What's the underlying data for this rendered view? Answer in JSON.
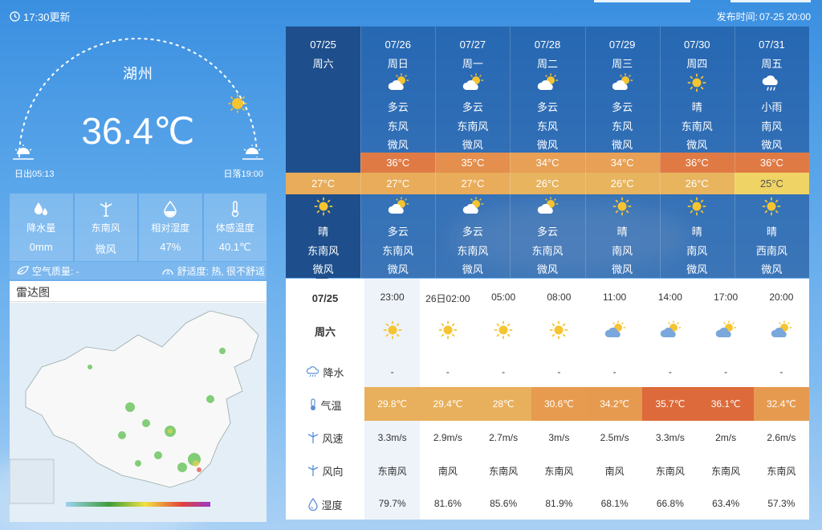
{
  "top": {
    "update_time": "17:30更新",
    "publish_label": "发布时间:",
    "publish_time": "07-25 20:00"
  },
  "current": {
    "city": "湖州",
    "temperature": "36.4℃",
    "sunrise": "日出05:13",
    "sunset": "日落19:00",
    "stats": [
      {
        "label": "降水量",
        "value": "0mm",
        "icon": "raindrops-icon"
      },
      {
        "label": "东南风",
        "value": "微风",
        "icon": "wind-turbine-icon"
      },
      {
        "label": "相对湿度",
        "value": "47%",
        "icon": "humidity-drop-icon"
      },
      {
        "label": "体感温度",
        "value": "40.1℃",
        "icon": "thermometer-icon"
      }
    ],
    "air_quality": "空气质量: -",
    "comfort": "舒适度: 热, 很不舒适"
  },
  "radar": {
    "title": "雷达图"
  },
  "forecast": [
    {
      "date": "07/25",
      "week": "周六",
      "day_weather": "",
      "day_wind_dir": "",
      "day_wind_power": "",
      "high": "",
      "low": "27°C",
      "night_weather": "晴",
      "night_wind_dir": "东南风",
      "night_wind_power": "微风",
      "day_icon": "",
      "night_icon": "sun-icon"
    },
    {
      "date": "07/26",
      "week": "周日",
      "day_weather": "多云",
      "day_wind_dir": "东风",
      "day_wind_power": "微风",
      "high": "36°C",
      "low": "27°C",
      "night_weather": "多云",
      "night_wind_dir": "东南风",
      "night_wind_power": "微风",
      "day_icon": "partly-cloudy-icon",
      "night_icon": "partly-cloudy-icon"
    },
    {
      "date": "07/27",
      "week": "周一",
      "day_weather": "多云",
      "day_wind_dir": "东南风",
      "day_wind_power": "微风",
      "high": "35°C",
      "low": "27°C",
      "night_weather": "多云",
      "night_wind_dir": "东南风",
      "night_wind_power": "微风",
      "day_icon": "partly-cloudy-icon",
      "night_icon": "partly-cloudy-icon"
    },
    {
      "date": "07/28",
      "week": "周二",
      "day_weather": "多云",
      "day_wind_dir": "东风",
      "day_wind_power": "微风",
      "high": "34°C",
      "low": "26°C",
      "night_weather": "多云",
      "night_wind_dir": "东南风",
      "night_wind_power": "微风",
      "day_icon": "partly-cloudy-icon",
      "night_icon": "partly-cloudy-icon"
    },
    {
      "date": "07/29",
      "week": "周三",
      "day_weather": "多云",
      "day_wind_dir": "东风",
      "day_wind_power": "微风",
      "high": "34°C",
      "low": "26°C",
      "night_weather": "晴",
      "night_wind_dir": "南风",
      "night_wind_power": "微风",
      "day_icon": "partly-cloudy-icon",
      "night_icon": "sun-icon"
    },
    {
      "date": "07/30",
      "week": "周四",
      "day_weather": "晴",
      "day_wind_dir": "东南风",
      "day_wind_power": "微风",
      "high": "36°C",
      "low": "26°C",
      "night_weather": "晴",
      "night_wind_dir": "南风",
      "night_wind_power": "微风",
      "day_icon": "sun-icon",
      "night_icon": "sun-icon"
    },
    {
      "date": "07/31",
      "week": "周五",
      "day_weather": "小雨",
      "day_wind_dir": "南风",
      "day_wind_power": "微风",
      "high": "36°C",
      "low": "25°C",
      "night_weather": "晴",
      "night_wind_dir": "西南风",
      "night_wind_power": "微风",
      "day_icon": "light-rain-icon",
      "night_icon": "sun-icon"
    }
  ],
  "colors": {
    "high_36": "#e07a45",
    "high_35": "#e48f4d",
    "high_34": "#e7a055",
    "low_27": "#e8ac5a",
    "low_26": "#e8b45e",
    "low_25": "#efd465"
  },
  "hourly": {
    "date": "07/25",
    "week": "周六",
    "row_labels": {
      "rain": "降水",
      "temp": "气温",
      "wind_speed": "风速",
      "wind_dir": "风向",
      "humidity": "湿度"
    },
    "items": [
      {
        "time": "23:00",
        "icon": "sun-icon",
        "rain": "-",
        "temp": "29.8℃",
        "temp_color": "#e8b05c",
        "wind_speed": "3.3m/s",
        "wind_dir": "东南风",
        "humidity": "79.7%"
      },
      {
        "time": "26日02:00",
        "icon": "sun-icon",
        "rain": "-",
        "temp": "29.4℃",
        "temp_color": "#e8b05c",
        "wind_speed": "2.9m/s",
        "wind_dir": "南风",
        "humidity": "81.6%"
      },
      {
        "time": "05:00",
        "icon": "sun-icon",
        "rain": "-",
        "temp": "28℃",
        "temp_color": "#e8b05c",
        "wind_speed": "2.7m/s",
        "wind_dir": "东南风",
        "humidity": "85.6%"
      },
      {
        "time": "08:00",
        "icon": "sun-icon",
        "rain": "-",
        "temp": "30.6℃",
        "temp_color": "#e79b4f",
        "wind_speed": "3m/s",
        "wind_dir": "东南风",
        "humidity": "81.9%"
      },
      {
        "time": "11:00",
        "icon": "partly-cloudy-icon",
        "rain": "-",
        "temp": "34.2℃",
        "temp_color": "#e69a4f",
        "wind_speed": "2.5m/s",
        "wind_dir": "南风",
        "humidity": "68.1%"
      },
      {
        "time": "14:00",
        "icon": "partly-cloudy-icon",
        "rain": "-",
        "temp": "35.7℃",
        "temp_color": "#dd6a3a",
        "wind_speed": "3.3m/s",
        "wind_dir": "东南风",
        "humidity": "66.8%"
      },
      {
        "time": "17:00",
        "icon": "partly-cloudy-icon",
        "rain": "-",
        "temp": "36.1℃",
        "temp_color": "#dd6a3a",
        "wind_speed": "2m/s",
        "wind_dir": "东南风",
        "humidity": "63.4%"
      },
      {
        "time": "20:00",
        "icon": "partly-cloudy-icon",
        "rain": "-",
        "temp": "32.4℃",
        "temp_color": "#e69a4f",
        "wind_speed": "2.6m/s",
        "wind_dir": "东南风",
        "humidity": "57.3%"
      }
    ]
  }
}
